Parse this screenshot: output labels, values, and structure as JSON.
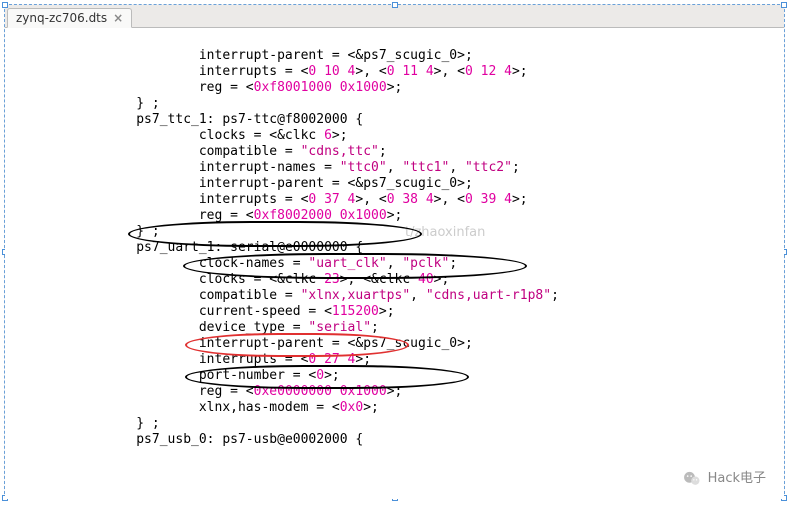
{
  "tab": {
    "filename": "zynq-zc706.dts",
    "close_glyph": "×"
  },
  "watermark": "t/zhaoxinfan",
  "brand": {
    "wechat_icon": "wechat-icon",
    "label": "Hack电子"
  },
  "code": {
    "l01": "interrupt-parent = <&ps7_scugic_0>;",
    "l02a": "interrupts = <",
    "l02n1": "0 10 4",
    "l02b": ">, <",
    "l02n2": "0 11 4",
    "l02c": ">, <",
    "l02n3": "0 12 4",
    "l02d": ">;",
    "l03a": "reg = <",
    "l03n": "0xf8001000 0x1000",
    "l03b": ">;",
    "l04": "} ;",
    "l05": "ps7_ttc_1: ps7-ttc@f8002000 {",
    "l06a": "clocks = <&clkc ",
    "l06n": "6",
    "l06b": ">;",
    "l07a": "compatible = ",
    "l07s": "\"cdns,ttc\"",
    "l07b": ";",
    "l08a": "interrupt-names = ",
    "l08s1": "\"ttc0\"",
    "l08b": ", ",
    "l08s2": "\"ttc1\"",
    "l08c": ", ",
    "l08s3": "\"ttc2\"",
    "l08d": ";",
    "l09": "interrupt-parent = <&ps7_scugic_0>;",
    "l10a": "interrupts = <",
    "l10n1": "0 37 4",
    "l10b": ">, <",
    "l10n2": "0 38 4",
    "l10c": ">, <",
    "l10n3": "0 39 4",
    "l10d": ">;",
    "l11a": "reg = <",
    "l11n": "0xf8002000 0x1000",
    "l11b": ">;",
    "l12": "} ;",
    "l13a": "ps7_uart_1: ",
    "l13b": "serial@e0000000 {",
    "l14a": "clock-names = ",
    "l14s1": "\"uart_clk\"",
    "l14b": ", ",
    "l14s2": "\"pclk\"",
    "l14c": ";",
    "l15a": "clocks = <&clkc ",
    "l15n1": "23",
    "l15b": ">, <&clkc ",
    "l15n2": "40",
    "l15c": ">;",
    "l16a": "compatible = ",
    "l16s1": "\"xlnx,xuartps\"",
    "l16b": ", ",
    "l16s2": "\"cdns,uart-r1p8\"",
    "l16c": ";",
    "l17a": "current-speed = <",
    "l17n": "115200",
    "l17b": ">;",
    "l18a": "device_type = ",
    "l18s": "\"serial\"",
    "l18b": ";",
    "l19": "interrupt-parent = <&ps7_scugic_0>;",
    "l20a": "interrupts = <",
    "l20n": "0 27 4",
    "l20b": ">;",
    "l21a": "port-number = <",
    "l21n": "0",
    "l21b": ">;",
    "l22a": "reg = <",
    "l22n": "0xe0000000 0x1000",
    "l22b": ">;",
    "l23a": "xlnx,has-modem = <",
    "l23n": "0x0",
    "l23b": ">;",
    "l24": "} ;",
    "l25": "ps7_usb_0: ps7-usb@e0002000 {"
  },
  "indent": {
    "i3": "            ",
    "i4": "                "
  }
}
